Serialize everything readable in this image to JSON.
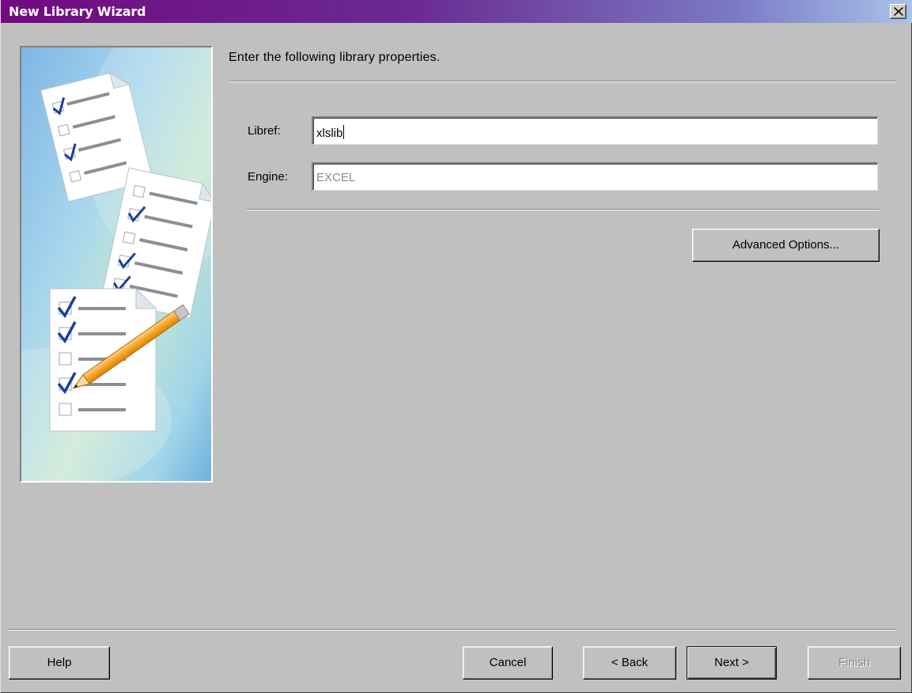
{
  "window": {
    "title": "New Library Wizard",
    "close_icon": "close-icon",
    "titlebar_colors": [
      "#720a80",
      "#a9c3ea"
    ]
  },
  "side_image": {
    "icon": "checklist-pencil-illustration"
  },
  "main": {
    "instructions": "Enter the following library properties.",
    "libref": {
      "label": "Libref:",
      "value": "xlslib"
    },
    "engine": {
      "label": "Engine:",
      "value": "EXCEL",
      "state": "disabled"
    },
    "advanced_options_label": "Advanced Options..."
  },
  "footer": {
    "help_label": "Help",
    "cancel_label": "Cancel",
    "back_label": "< Back",
    "next_label": "Next >",
    "finish_label": "Finish",
    "finish_state": "disabled"
  }
}
